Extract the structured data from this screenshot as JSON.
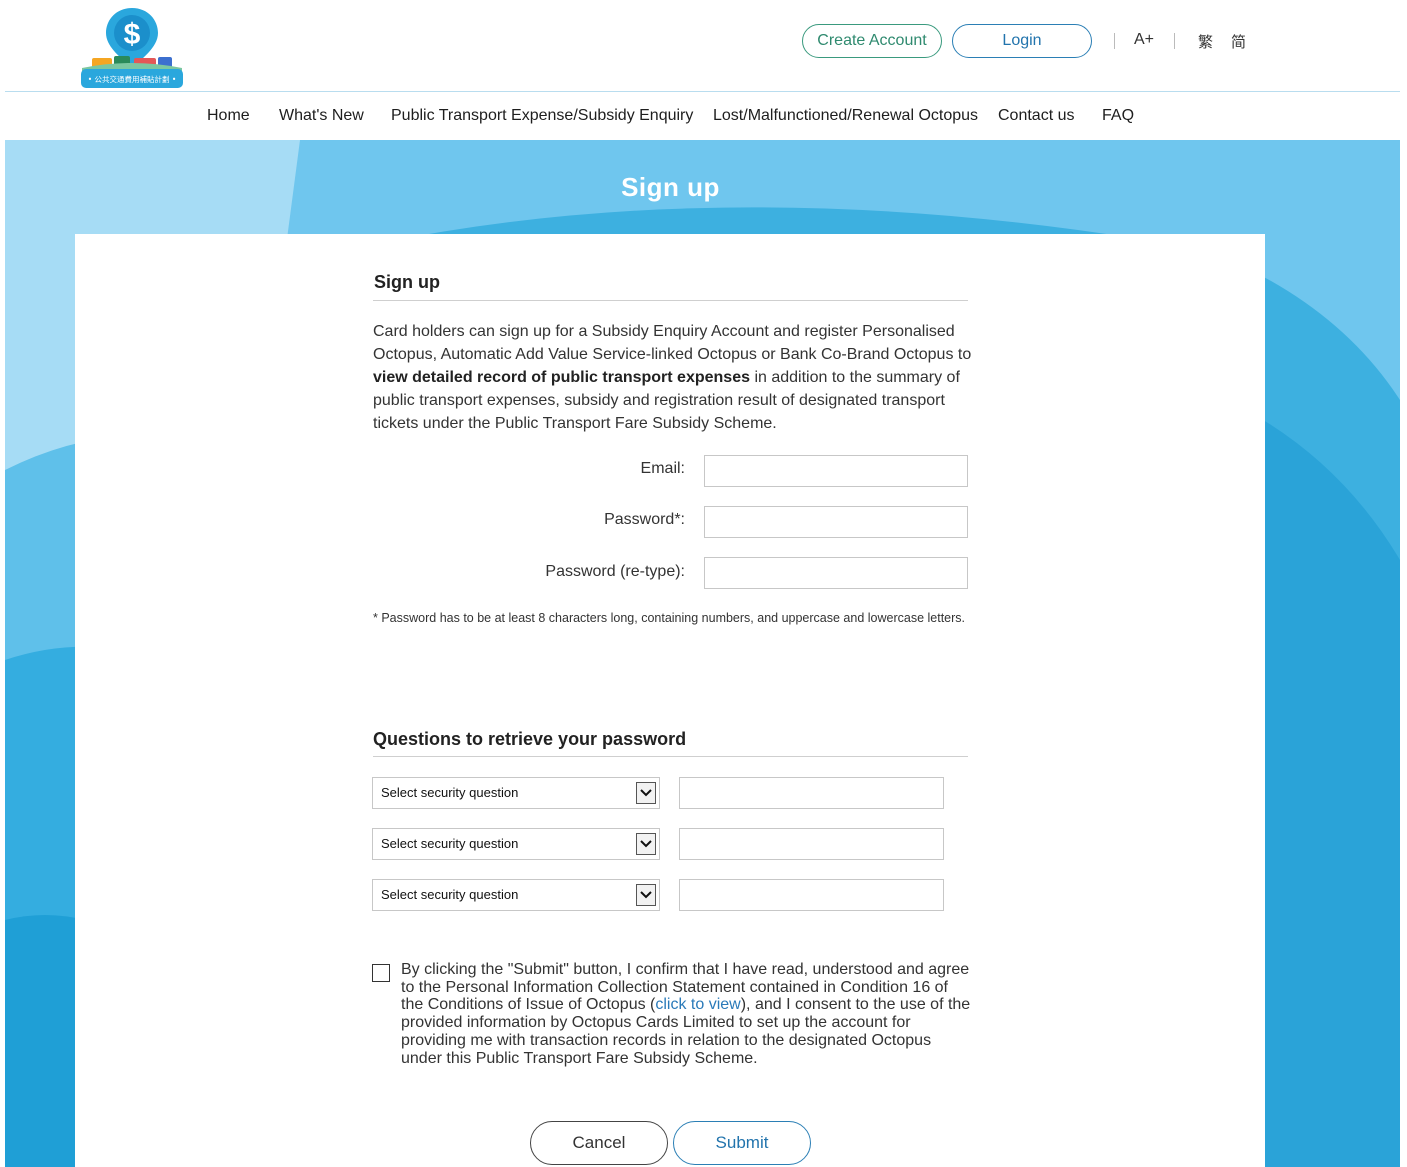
{
  "header": {
    "create_account": "Create Account",
    "login": "Login",
    "font_size": "A+",
    "lang_traditional": "繁",
    "lang_simplified": "简"
  },
  "logo": {
    "symbol": "$",
    "caption": "• 公共交通費用補貼計劃 •"
  },
  "nav": {
    "items": [
      {
        "label": "Home"
      },
      {
        "label": "What's New"
      },
      {
        "label": "Public Transport Expense/Subsidy Enquiry"
      },
      {
        "label": "Lost/Malfunctioned/Renewal Octopus"
      },
      {
        "label": "Contact us"
      },
      {
        "label": "FAQ"
      }
    ]
  },
  "banner": {
    "title": "Sign up"
  },
  "signup": {
    "section_title": "Sign up",
    "intro_part1": "Card holders can sign up for a Subsidy Enquiry Account and register Personalised Octopus, Automatic Add Value Service-linked Octopus or Bank Co-Brand Octopus to ",
    "intro_bold": "view detailed record of public transport expenses",
    "intro_part2": " in addition to the summary of public transport expenses, subsidy and registration result of designated transport tickets under the Public Transport Fare Subsidy Scheme.",
    "email_label": "Email:",
    "password_label": "Password*:",
    "password_retype_label": "Password (re-type):",
    "password_note": "* Password has to be at least 8 characters long, containing numbers, and uppercase and lowercase letters."
  },
  "security": {
    "section_title": "Questions to retrieve your password",
    "questions": [
      {
        "selected": "Select security question"
      },
      {
        "selected": "Select security question"
      },
      {
        "selected": "Select security question"
      }
    ]
  },
  "consent": {
    "text_before_link": "By clicking the \"Submit\" button, I confirm that I have read, understood and agree to the Personal Information Collection Statement contained in Condition 16 of the Conditions of Issue of Octopus (",
    "link_text": "click to view",
    "text_after_link": "), and I consent to the use of the provided information by Octopus Cards Limited to set up the account for providing me with transaction records in relation to the designated Octopus under this Public Transport Fare Subsidy Scheme."
  },
  "actions": {
    "cancel": "Cancel",
    "submit": "Submit"
  },
  "colors": {
    "banner_light": "#a6dcf5",
    "banner_mid": "#6fc6ee",
    "banner_deep": "#2aa3d8",
    "link_blue": "#2a7ab9",
    "create_green": "#3a9a7e"
  }
}
